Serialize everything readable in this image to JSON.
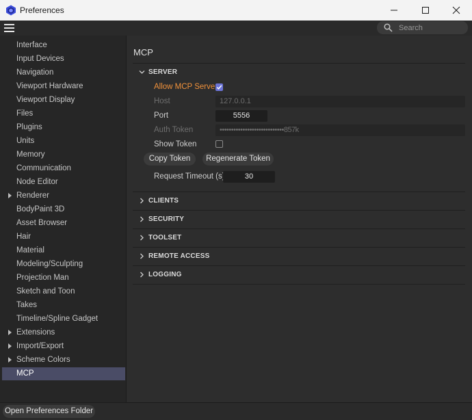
{
  "window": {
    "title": "Preferences",
    "icon": "cinema4d-cube-icon"
  },
  "toolbar": {
    "menu_icon": "hamburger-menu-icon",
    "search_placeholder": "Search"
  },
  "sidebar": {
    "items": [
      {
        "label": "Interface",
        "expandable": false,
        "selected": false
      },
      {
        "label": "Input Devices",
        "expandable": false,
        "selected": false
      },
      {
        "label": "Navigation",
        "expandable": false,
        "selected": false
      },
      {
        "label": "Viewport Hardware",
        "expandable": false,
        "selected": false
      },
      {
        "label": "Viewport Display",
        "expandable": false,
        "selected": false
      },
      {
        "label": "Files",
        "expandable": false,
        "selected": false
      },
      {
        "label": "Plugins",
        "expandable": false,
        "selected": false
      },
      {
        "label": "Units",
        "expandable": false,
        "selected": false
      },
      {
        "label": "Memory",
        "expandable": false,
        "selected": false
      },
      {
        "label": "Communication",
        "expandable": false,
        "selected": false
      },
      {
        "label": "Node Editor",
        "expandable": false,
        "selected": false
      },
      {
        "label": "Renderer",
        "expandable": true,
        "selected": false
      },
      {
        "label": "BodyPaint 3D",
        "expandable": false,
        "selected": false
      },
      {
        "label": "Asset Browser",
        "expandable": false,
        "selected": false
      },
      {
        "label": "Hair",
        "expandable": false,
        "selected": false
      },
      {
        "label": "Material",
        "expandable": false,
        "selected": false
      },
      {
        "label": "Modeling/Sculpting",
        "expandable": false,
        "selected": false
      },
      {
        "label": "Projection Man",
        "expandable": false,
        "selected": false
      },
      {
        "label": "Sketch and Toon",
        "expandable": false,
        "selected": false
      },
      {
        "label": "Takes",
        "expandable": false,
        "selected": false
      },
      {
        "label": "Timeline/Spline Gadget",
        "expandable": false,
        "selected": false
      },
      {
        "label": "Extensions",
        "expandable": true,
        "selected": false
      },
      {
        "label": "Import/Export",
        "expandable": true,
        "selected": false
      },
      {
        "label": "Scheme Colors",
        "expandable": true,
        "selected": false
      },
      {
        "label": "MCP",
        "expandable": false,
        "selected": true
      }
    ]
  },
  "main": {
    "title": "MCP",
    "server": {
      "header": "SERVER",
      "allow_label": "Allow MCP Server",
      "allow_checked": true,
      "host_label": "Host",
      "host_value": "127.0.0.1",
      "port_label": "Port",
      "port_value": "5556",
      "auth_label": "Auth Token",
      "auth_value": "••••••••••••••••••••••••••••857k",
      "show_token_label": "Show Token",
      "show_token_checked": false,
      "copy_token_label": "Copy Token",
      "regenerate_token_label": "Regenerate Token",
      "timeout_label": "Request Timeout (s)",
      "timeout_value": "30"
    },
    "sections": [
      {
        "label": "CLIENTS"
      },
      {
        "label": "SECURITY"
      },
      {
        "label": "TOOLSET"
      },
      {
        "label": "REMOTE ACCESS"
      },
      {
        "label": "LOGGING"
      }
    ]
  },
  "footer": {
    "open_folder_label": "Open Preferences Folder"
  },
  "colors": {
    "accent_orange": "#f0913b",
    "checkbox_blue": "#6c74d6",
    "selected_item": "#4a4c66"
  }
}
